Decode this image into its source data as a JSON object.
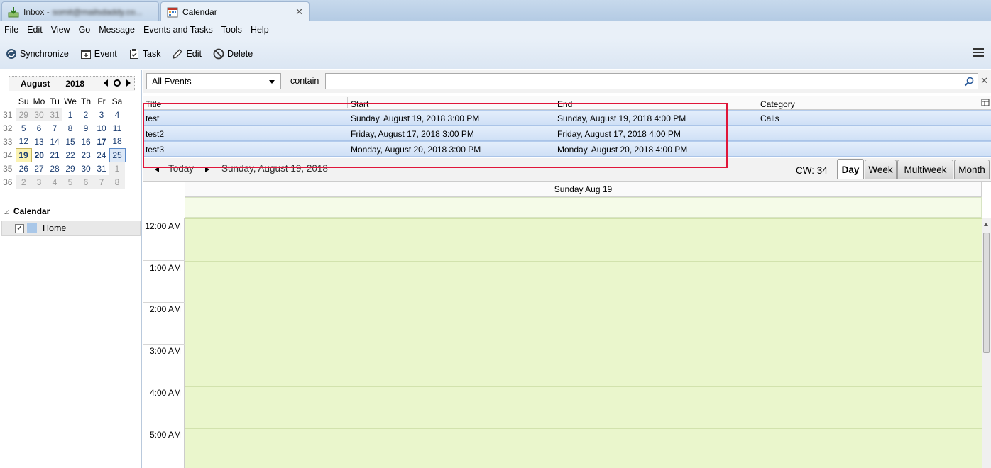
{
  "tabs": [
    {
      "label": "Inbox - ",
      "blurred": "somit@mailsdaddy.co..."
    },
    {
      "label": "Calendar"
    }
  ],
  "menu": [
    "File",
    "Edit",
    "View",
    "Go",
    "Message",
    "Events and Tasks",
    "Tools",
    "Help"
  ],
  "toolbar": {
    "synchronize": "Synchronize",
    "event": "Event",
    "task": "Task",
    "edit": "Edit",
    "delete": "Delete"
  },
  "minimonth": {
    "month": "August",
    "year": "2018",
    "dow": [
      "Su",
      "Mo",
      "Tu",
      "We",
      "Th",
      "Fr",
      "Sa"
    ],
    "weeks": [
      {
        "wk": "31",
        "days": [
          "29",
          "30",
          "31",
          "1",
          "2",
          "3",
          "4"
        ]
      },
      {
        "wk": "32",
        "days": [
          "5",
          "6",
          "7",
          "8",
          "9",
          "10",
          "11"
        ]
      },
      {
        "wk": "33",
        "days": [
          "12",
          "13",
          "14",
          "15",
          "16",
          "17",
          "18"
        ]
      },
      {
        "wk": "34",
        "days": [
          "19",
          "20",
          "21",
          "22",
          "23",
          "24",
          "25"
        ]
      },
      {
        "wk": "35",
        "days": [
          "26",
          "27",
          "28",
          "29",
          "30",
          "31",
          "1"
        ]
      },
      {
        "wk": "36",
        "days": [
          "2",
          "3",
          "4",
          "5",
          "6",
          "7",
          "8"
        ]
      }
    ]
  },
  "calendars": {
    "header": "Calendar",
    "items": [
      {
        "name": "Home",
        "checked": true,
        "color": "#a9c7e8"
      }
    ]
  },
  "filter": {
    "selected": "All Events",
    "contain_label": "contain",
    "search_value": ""
  },
  "event_list": {
    "columns": [
      "Title",
      "Start",
      "End",
      "Category"
    ],
    "rows": [
      [
        "test",
        "Sunday, August 19, 2018 3:00 PM",
        "Sunday, August 19, 2018 4:00 PM",
        "Calls"
      ],
      [
        "test2",
        "Friday, August 17, 2018 3:00 PM",
        "Friday, August 17, 2018 4:00 PM",
        ""
      ],
      [
        "test3",
        "Monday, August 20, 2018 3:00 PM",
        "Monday, August 20, 2018 4:00 PM",
        ""
      ]
    ]
  },
  "day_view": {
    "today_label": "Today",
    "date_label": "Sunday, August 19, 2018",
    "cw_label": "CW: 34",
    "view_tabs": [
      "Day",
      "Week",
      "Multiweek",
      "Month"
    ],
    "active_view": "Day",
    "column_header": "Sunday Aug 19",
    "hours": [
      "12:00 AM",
      "1:00 AM",
      "2:00 AM",
      "3:00 AM",
      "4:00 AM",
      "5:00 AM"
    ]
  },
  "colors": {
    "highlight_box": "#e0163a",
    "day_grid": "#eaf6cc",
    "selected_row": "#cfe0f6"
  }
}
